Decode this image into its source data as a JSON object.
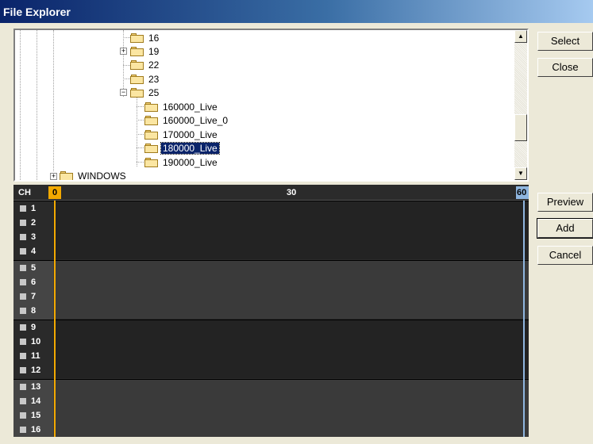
{
  "window": {
    "title": "File Explorer"
  },
  "tree": {
    "nodes": [
      {
        "label": "16",
        "selected": false
      },
      {
        "label": "19",
        "selected": false,
        "expander": "+"
      },
      {
        "label": "22",
        "selected": false
      },
      {
        "label": "23",
        "selected": false
      },
      {
        "label": "25",
        "selected": false,
        "expander": "−"
      },
      {
        "label": "160000_Live",
        "selected": false
      },
      {
        "label": "160000_Live_0",
        "selected": false
      },
      {
        "label": "170000_Live",
        "selected": false
      },
      {
        "label": "180000_Live",
        "selected": true
      },
      {
        "label": "190000_Live",
        "selected": false
      },
      {
        "label": "WINDOWS",
        "selected": false,
        "expander": "+"
      }
    ]
  },
  "buttons": {
    "select": "Select",
    "close": "Close",
    "preview": "Preview",
    "add": "Add",
    "cancel": "Cancel"
  },
  "timeline": {
    "header_label": "CH",
    "ticks": [
      "0",
      "30",
      "60"
    ],
    "channels": [
      "1",
      "2",
      "3",
      "4",
      "5",
      "6",
      "7",
      "8",
      "9",
      "10",
      "11",
      "12",
      "13",
      "14",
      "15",
      "16"
    ]
  },
  "colors": {
    "title_bar": "#0a246a",
    "playhead": "#f2a900",
    "end_marker": "#8fb6df",
    "selection": "#0a246a"
  }
}
